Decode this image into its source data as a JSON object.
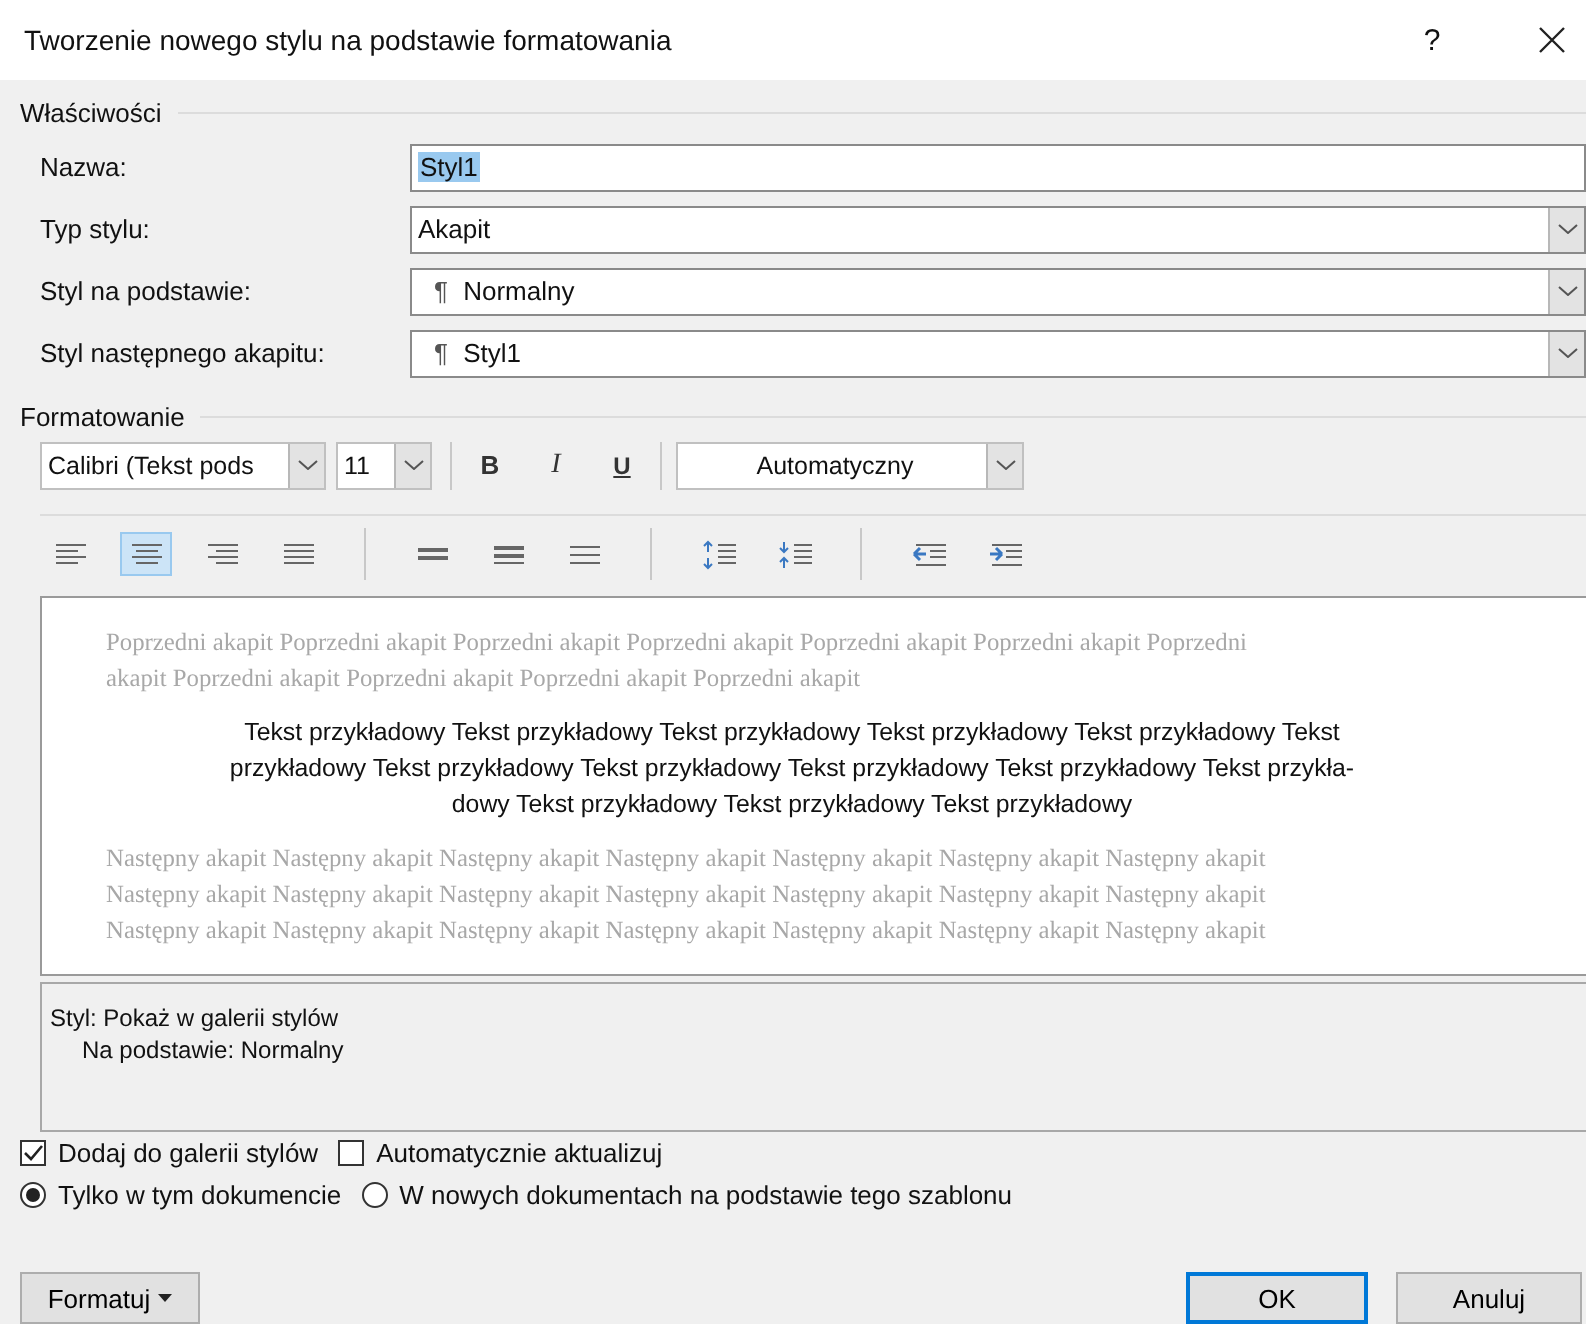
{
  "window": {
    "title": "Tworzenie nowego stylu na podstawie formatowania",
    "help": "?"
  },
  "properties": {
    "legend": "Właściwości",
    "fields": [
      {
        "label": "Nazwa:",
        "kind": "text",
        "value": "Styl1",
        "highlighted": true
      },
      {
        "label": "Typ stylu:",
        "kind": "dropdown",
        "value": "Akapit"
      },
      {
        "label": "Styl na podstawie:",
        "kind": "dropdown",
        "mark": "¶",
        "value": "Normalny"
      },
      {
        "label": "Styl następnego akapitu:",
        "kind": "dropdown",
        "mark": "¶",
        "value": "Styl1"
      }
    ]
  },
  "formatting": {
    "legend": "Formatowanie",
    "font": "Calibri (Tekst pods",
    "size": "11",
    "bold": "B",
    "italic": "I",
    "underline": "U",
    "font_color": "Automatyczny",
    "alignment": [
      {
        "selected": false
      },
      {
        "selected": true
      },
      {
        "selected": false
      },
      {
        "selected": false
      }
    ]
  },
  "preview": {
    "previous_lines": [
      "Poprzedni akapit Poprzedni akapit Poprzedni akapit Poprzedni akapit Poprzedni akapit Poprzedni akapit Poprzedni",
      "akapit Poprzedni akapit Poprzedni akapit Poprzedni akapit Poprzedni akapit"
    ],
    "sample_lines": [
      "Tekst przykładowy Tekst przykładowy Tekst przykładowy Tekst przykładowy Tekst przykładowy Tekst",
      "przykładowy Tekst przykładowy Tekst przykładowy Tekst przykładowy Tekst przykładowy Tekst przykła-",
      "dowy Tekst przykładowy Tekst przykładowy Tekst przykładowy"
    ],
    "next_lines": [
      "Następny akapit Następny akapit Następny akapit Następny akapit Następny akapit Następny akapit Następny akapit",
      "Następny akapit Następny akapit Następny akapit Następny akapit Następny akapit Następny akapit Następny akapit",
      "Następny akapit Następny akapit Następny akapit Następny akapit Następny akapit Następny akapit Następny akapit"
    ]
  },
  "description": {
    "lines": [
      "Styl: Pokaż w galerii stylów",
      "Na podstawie: Normalny"
    ]
  },
  "options": {
    "checkboxes": [
      {
        "label": "Dodaj do galerii stylów",
        "checked": true
      },
      {
        "label": "Automatycznie aktualizuj",
        "checked": false
      }
    ],
    "radios": [
      {
        "label": "Tylko w tym dokumencie",
        "selected": true
      },
      {
        "label": "W nowych dokumentach na podstawie tego szablonu",
        "selected": false
      }
    ]
  },
  "buttons": {
    "format": "Formatuj",
    "ok": "OK",
    "cancel": "Anuluj"
  }
}
